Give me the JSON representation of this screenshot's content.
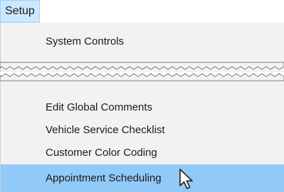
{
  "menubar": {
    "setup_label": "Setup"
  },
  "menu": {
    "top_items": [
      "System Controls"
    ],
    "bottom_items": [
      "Edit Global Comments",
      "Vehicle Service Checklist",
      "Customer Color Coding",
      "Appointment Scheduling"
    ],
    "highlighted_item": "Appointment Scheduling"
  },
  "colors": {
    "menubar_tab_bg": "#cce8ff",
    "menu_bg": "#f2f2f2",
    "highlight_bg": "#91c9f7"
  },
  "icons": {
    "pointer": "mouse-pointer-icon"
  }
}
